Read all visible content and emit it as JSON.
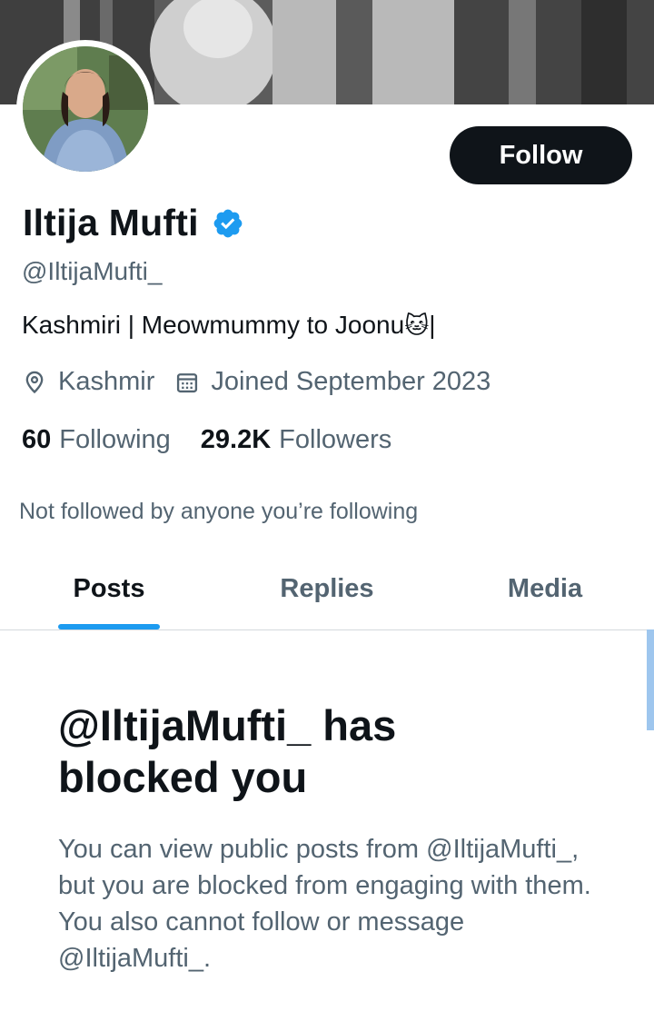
{
  "profile": {
    "display_name": "Iltija Mufti",
    "verified": true,
    "handle": "@IltijaMufti_",
    "bio": "Kashmiri | Meowmummy to Joonu",
    "bio_emoji": "🐱",
    "bio_tail": "|",
    "location": "Kashmir",
    "joined": "Joined September 2023",
    "following_count": "60",
    "following_label": "Following",
    "followers_count": "29.2K",
    "followers_label": "Followers",
    "mutuals_note": "Not followed by anyone you’re following"
  },
  "actions": {
    "follow_label": "Follow"
  },
  "tabs": [
    {
      "label": "Posts",
      "active": true
    },
    {
      "label": "Replies",
      "active": false
    },
    {
      "label": "Media",
      "active": false
    }
  ],
  "blocked": {
    "title": "@IltijaMufti_ has blocked you",
    "message": "You can view public posts from @IltijaMufti_, but you are blocked from engaging with them. You also cannot follow or message @IltijaMufti_."
  },
  "icons": {
    "verified": "verified-badge-icon",
    "location": "location-pin-icon",
    "calendar": "calendar-icon"
  },
  "colors": {
    "accent": "#1d9bf0",
    "text_primary": "#0f1419",
    "text_secondary": "#536471",
    "button_bg": "#0f1419"
  }
}
